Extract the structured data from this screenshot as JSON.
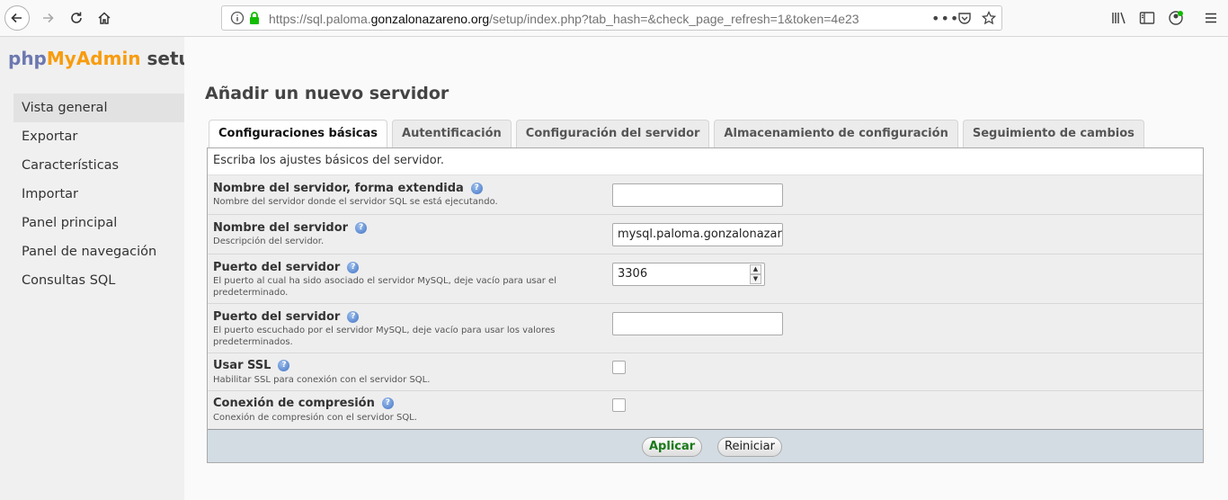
{
  "browser": {
    "url_prefix": "https://sql.paloma.",
    "url_domain": "gonzalonazareno.org",
    "url_suffix": "/setup/index.php?tab_hash=&check_page_refresh=1&token=4e23"
  },
  "logo": {
    "php": "php",
    "myadmin": "MyAdmin",
    "setup": "setup"
  },
  "sidebar": {
    "items": [
      {
        "label": "Vista general",
        "active": true
      },
      {
        "label": "Exportar"
      },
      {
        "label": "Características"
      },
      {
        "label": "Importar"
      },
      {
        "label": "Panel principal"
      },
      {
        "label": "Panel de navegación"
      },
      {
        "label": "Consultas SQL"
      }
    ]
  },
  "main": {
    "title": "Añadir un nuevo servidor",
    "tabs": [
      {
        "label": "Configuraciones básicas",
        "active": true
      },
      {
        "label": "Autentificación"
      },
      {
        "label": "Configuración del servidor"
      },
      {
        "label": "Almacenamiento de configuración"
      },
      {
        "label": "Seguimiento de cambios"
      }
    ],
    "panel_description": "Escriba los ajustes básicos del servidor.",
    "fields": [
      {
        "label": "Nombre del servidor, forma extendida",
        "description": "Nombre del servidor donde el servidor SQL se está ejecutando.",
        "value": ""
      },
      {
        "label": "Nombre del servidor",
        "description": "Descripción del servidor.",
        "value": "mysql.paloma.gonzalonazareno.org"
      },
      {
        "label": "Puerto del servidor",
        "description": "El puerto al cual ha sido asociado el servidor MySQL, deje vacío para usar el predeterminado.",
        "value": "3306"
      },
      {
        "label": "Puerto del servidor",
        "description": "El puerto escuchado por el servidor MySQL, deje vacío para usar los valores predeterminados.",
        "value": ""
      },
      {
        "label": "Usar SSL",
        "description": "Habilitar SSL para conexión con el servidor SQL.",
        "checked": false
      },
      {
        "label": "Conexión de compresión",
        "description": "Conexión de compresión con el servidor SQL.",
        "checked": false
      }
    ],
    "buttons": {
      "apply": "Aplicar",
      "reset": "Reiniciar"
    }
  },
  "colors": {
    "logo_php": "#6c78af",
    "logo_myadmin": "#f89c0e",
    "apply_text": "#1a7a1a",
    "footer_bg": "#d3dce3"
  }
}
